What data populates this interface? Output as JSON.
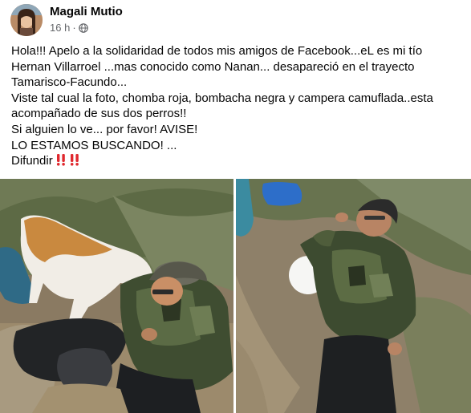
{
  "post": {
    "author": "Magali Mutio",
    "time": "16 h",
    "privacy_icon": "globe-icon",
    "lines": [
      "Hola!!! Apelo a la solidaridad de todos mis amigos de Facebook...eL es mi tío",
      "Hernan Villarroel ...mas conocido como Nanan... desapareció en el trayecto",
      "Tamarisco-Facundo...",
      "Viste tal cual la foto, chomba roja, bombacha negra y campera camuflada..esta",
      "acompañado de sus dos perros!!",
      "Si alguien lo ve... por favor! AVISE!",
      "LO ESTAMOS BUSCANDO! ...",
      "Difundir"
    ],
    "emoji": [
      "double-exclamation-icon",
      "double-exclamation-icon"
    ],
    "colors": {
      "text": "#050505",
      "meta": "#65676b",
      "emoji_red": "#e0282e"
    }
  },
  "photos": [
    {
      "name": "photo-man-with-dogs"
    },
    {
      "name": "photo-man-lying-on-ground"
    }
  ]
}
